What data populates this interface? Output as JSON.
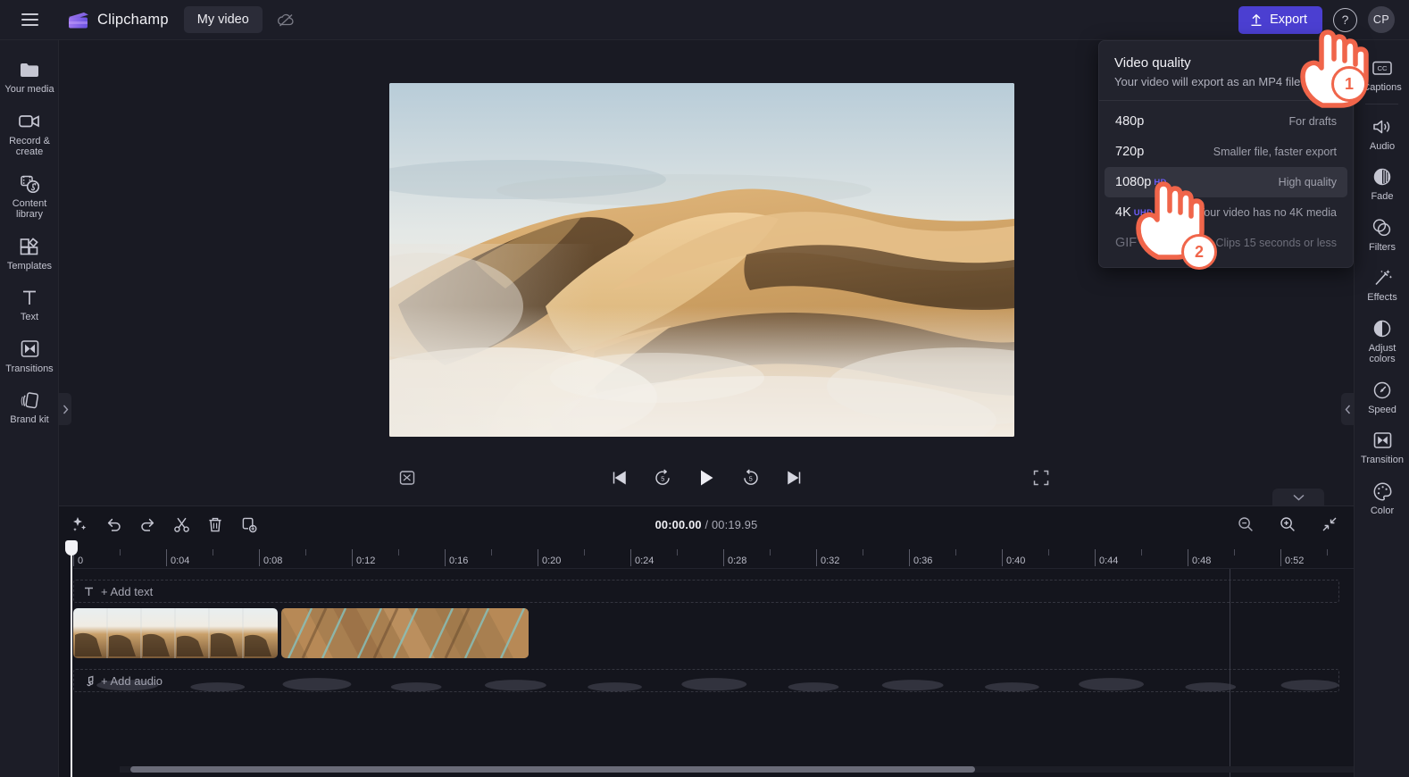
{
  "topbar": {
    "menu_icon": "hamburger-icon",
    "brand_name": "Clipchamp",
    "project_name": "My video",
    "cloud_icon": "cloud-off-icon",
    "export_label": "Export",
    "export_icon": "upload-arrow-icon",
    "help_label": "?",
    "avatar_initials": "CP",
    "accent_color": "#4b3fd1"
  },
  "left_rail": {
    "items": [
      {
        "label": "Your media",
        "icon": "folder-icon"
      },
      {
        "label": "Record &\ncreate",
        "icon": "video-camera-icon"
      },
      {
        "label": "Content\nlibrary",
        "icon": "content-library-icon"
      },
      {
        "label": "Templates",
        "icon": "templates-grid-icon"
      },
      {
        "label": "Text",
        "icon": "text-t-icon"
      },
      {
        "label": "Transitions",
        "icon": "transitions-icon"
      },
      {
        "label": "Brand kit",
        "icon": "brand-kit-icon"
      }
    ]
  },
  "right_rail": {
    "items": [
      {
        "label": "Captions",
        "icon": "closed-captions-icon"
      },
      {
        "label": "Audio",
        "icon": "speaker-icon"
      },
      {
        "label": "Fade",
        "icon": "fade-icon"
      },
      {
        "label": "Filters",
        "icon": "filters-circles-icon"
      },
      {
        "label": "Effects",
        "icon": "magic-wand-icon"
      },
      {
        "label": "Adjust\ncolors",
        "icon": "contrast-circle-icon"
      },
      {
        "label": "Speed",
        "icon": "speedometer-icon"
      },
      {
        "label": "Transition",
        "icon": "transition-icon"
      },
      {
        "label": "Color",
        "icon": "color-palette-icon"
      }
    ]
  },
  "player": {
    "mute_icon": "mute-icon",
    "skip_start_icon": "skip-to-start-icon",
    "back5_icon": "rewind-5-icon",
    "play_icon": "play-icon",
    "fwd5_icon": "forward-5-icon",
    "skip_end_icon": "skip-to-end-icon",
    "fullscreen_icon": "fullscreen-icon"
  },
  "timeline": {
    "tools": [
      {
        "icon": "magic-sparkle-icon",
        "name": "auto-compose"
      },
      {
        "icon": "undo-icon",
        "name": "undo"
      },
      {
        "icon": "redo-icon",
        "name": "redo"
      },
      {
        "icon": "scissors-icon",
        "name": "split"
      },
      {
        "icon": "trash-icon",
        "name": "delete"
      },
      {
        "icon": "duplicate-icon",
        "name": "duplicate"
      }
    ],
    "current_time": "00:00.00",
    "total_time": "/ 00:19.95",
    "zoom_out_icon": "zoom-out-icon",
    "zoom_in_icon": "zoom-in-icon",
    "fit_icon": "fit-to-screen-icon",
    "ruler_labels": [
      "0",
      "0:04",
      "0:08",
      "0:12",
      "0:16",
      "0:20",
      "0:24",
      "0:28",
      "0:32",
      "0:36",
      "0:40",
      "0:44",
      "0:48",
      "0:52"
    ],
    "add_text_label": "+ Add text",
    "add_text_icon": "text-t-icon",
    "add_audio_label": "+ Add audio",
    "add_audio_icon": "music-note-icon",
    "clips": [
      {
        "name": "video-clip-dunes"
      },
      {
        "name": "video-clip-aerial"
      }
    ]
  },
  "export_dropdown": {
    "title": "Video quality",
    "subtitle": "Your video will export as an MP4 file",
    "options": [
      {
        "name": "480p",
        "badge": "",
        "desc": "For drafts",
        "selected": false,
        "disabled": false
      },
      {
        "name": "720p",
        "badge": "",
        "desc": "Smaller file, faster export",
        "selected": false,
        "disabled": false
      },
      {
        "name": "1080p",
        "badge": "HD",
        "desc": "High quality",
        "selected": true,
        "disabled": false
      },
      {
        "name": "4K",
        "badge": "UHD",
        "desc": "Your video has no 4K media",
        "selected": false,
        "disabled": true
      },
      {
        "name": "GIF",
        "badge": "",
        "desc": "Clips 15 seconds or less",
        "selected": false,
        "disabled": true
      }
    ]
  },
  "annotations": {
    "step1": "1",
    "step2": "2",
    "badge_color": "#f0654a"
  }
}
